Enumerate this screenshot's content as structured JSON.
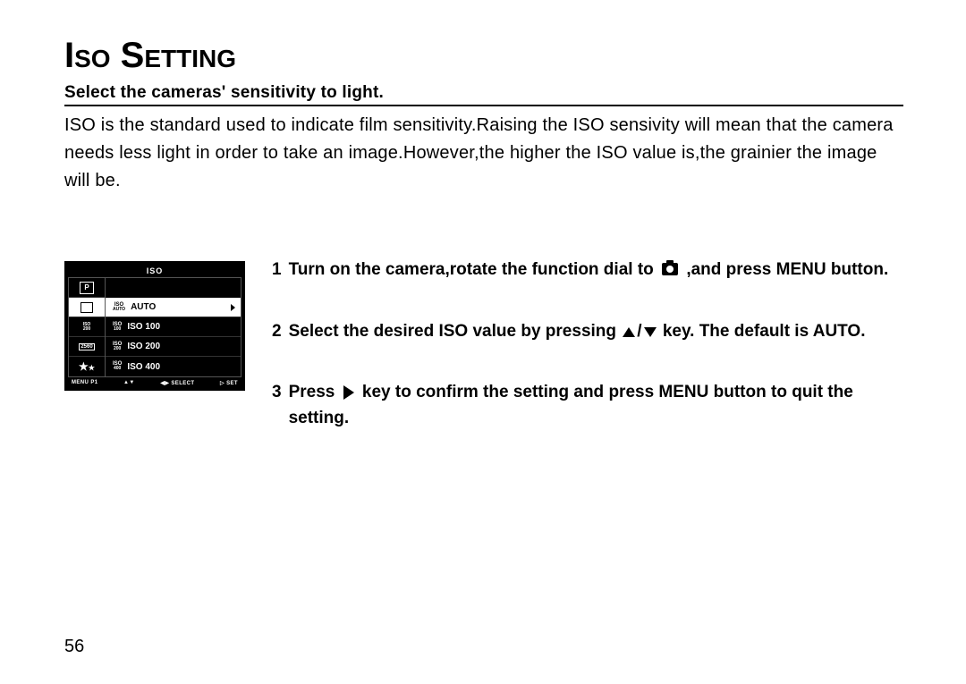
{
  "page": {
    "title": "Iso Setting",
    "subheading": "Select the cameras' sensitivity to light.",
    "body": "ISO is the standard used to indicate film sensitivity.Raising the ISO sensivity will mean that the camera needs less light in order to take an image.However,the higher the ISO value is,the grainier the image will be.",
    "page_number": "56"
  },
  "screen": {
    "title": "ISO",
    "left": [
      "P",
      "□",
      "ISO 200",
      "2560",
      "★★"
    ],
    "options": [
      {
        "badge_top": "ISO",
        "badge_bot": "AUTO",
        "label": "AUTO",
        "selected": true
      },
      {
        "badge_top": "ISO",
        "badge_bot": "100",
        "label": "ISO 100",
        "selected": false
      },
      {
        "badge_top": "ISO",
        "badge_bot": "200",
        "label": "ISO 200",
        "selected": false
      },
      {
        "badge_top": "ISO",
        "badge_bot": "400",
        "label": "ISO 400",
        "selected": false
      }
    ],
    "footer": {
      "menu": "MENU P1",
      "nav": "▲▼",
      "sel": "◀▶ SELECT",
      "set": "▷ SET"
    }
  },
  "steps": [
    {
      "n": "1",
      "pre": "Turn on the camera,rotate the function dial to ",
      "post": " ,and press MENU button.",
      "icon": "camera"
    },
    {
      "n": "2",
      "pre": "Select the desired ISO value by pressing ",
      "post": " key. The default is AUTO.",
      "icon": "updown"
    },
    {
      "n": "3",
      "pre": "Press ",
      "post": " key to confirm the setting and press MENU button to quit the setting.",
      "icon": "right"
    }
  ]
}
